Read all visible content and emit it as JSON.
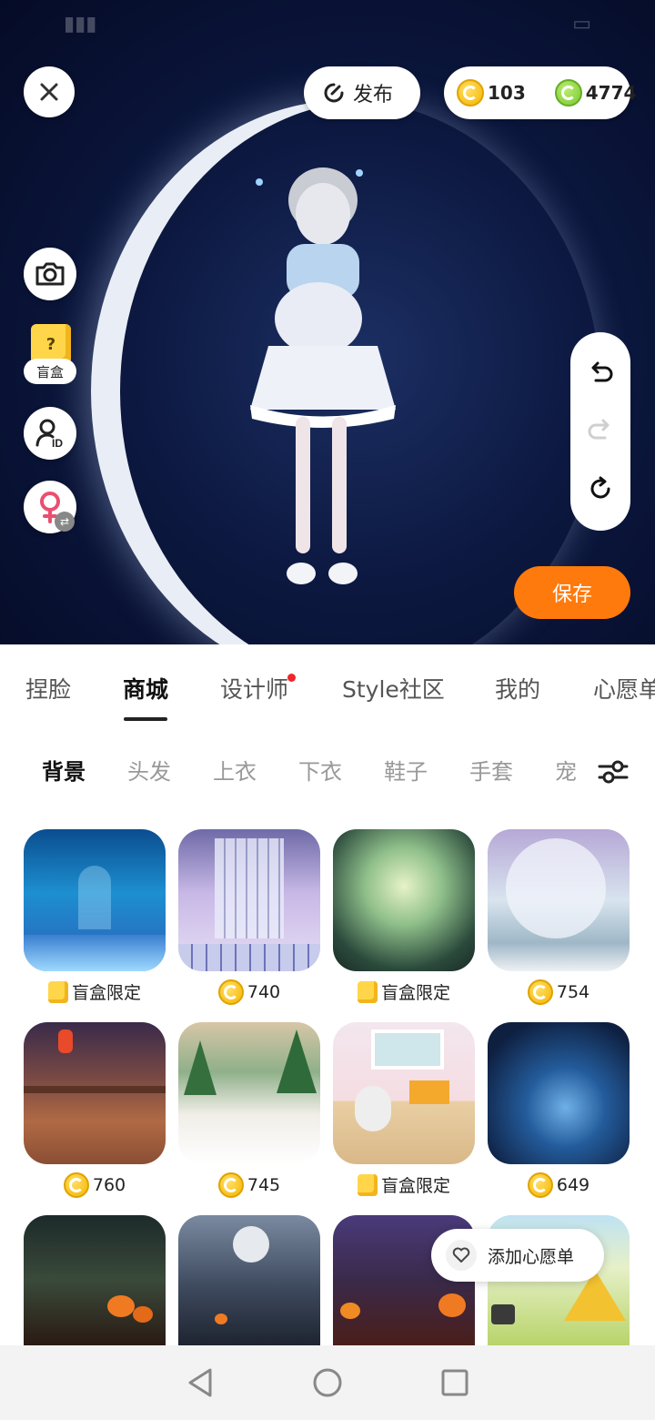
{
  "colors": {
    "accent_orange": "#ff7a0c",
    "scene_bg": "#0c1840",
    "red_dot": "#f0262b",
    "gold_coin": "#f5b400",
    "green_coin": "#7cc832"
  },
  "header": {
    "publish_label": "发布",
    "gold_amount": "103",
    "green_amount": "4774"
  },
  "side": {
    "blindbox_label": "盲盒"
  },
  "actions": {
    "save_label": "保存"
  },
  "main_tabs": [
    {
      "label": "捏脸",
      "active": false
    },
    {
      "label": "商城",
      "active": true
    },
    {
      "label": "设计师",
      "active": false,
      "dot": true
    },
    {
      "label": "Style社区",
      "active": false
    },
    {
      "label": "我的",
      "active": false
    },
    {
      "label": "心愿单",
      "active": false
    }
  ],
  "sub_tabs": [
    {
      "label": "背景",
      "active": true
    },
    {
      "label": "头发"
    },
    {
      "label": "上衣"
    },
    {
      "label": "下衣"
    },
    {
      "label": "鞋子"
    },
    {
      "label": "手套"
    },
    {
      "label": "宠"
    }
  ],
  "items": [
    {
      "price": "盲盒限定",
      "type": "blindbox",
      "theme": "underwater"
    },
    {
      "price": "740",
      "type": "coin",
      "theme": "palace-window"
    },
    {
      "price": "盲盒限定",
      "type": "blindbox",
      "theme": "misty-moon"
    },
    {
      "price": "754",
      "type": "coin",
      "theme": "lilac-garden"
    },
    {
      "price": "760",
      "type": "coin",
      "theme": "lantern-bridge"
    },
    {
      "price": "745",
      "type": "coin",
      "theme": "christmas"
    },
    {
      "price": "盲盒限定",
      "type": "blindbox",
      "theme": "cozy-room"
    },
    {
      "price": "649",
      "type": "coin",
      "theme": "blue-night-forest"
    },
    {
      "price": "",
      "type": "none",
      "theme": "halloween-tree"
    },
    {
      "price": "",
      "type": "none",
      "theme": "moon-street"
    },
    {
      "price": "",
      "type": "none",
      "theme": "pumpkin-forest"
    },
    {
      "price": "",
      "type": "none",
      "theme": "tent-meadow"
    }
  ],
  "wishlist": {
    "label": "添加心愿单"
  }
}
